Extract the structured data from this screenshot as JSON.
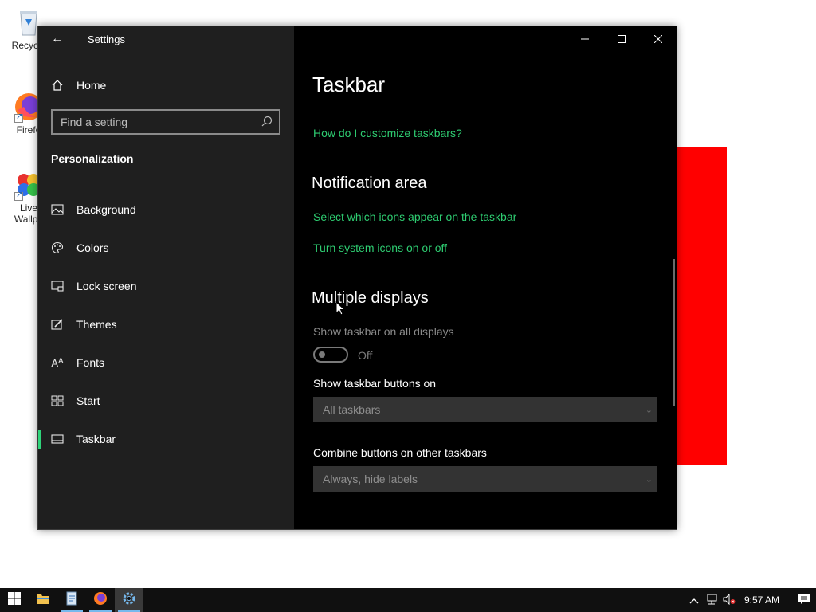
{
  "desktop": {
    "icons": [
      {
        "label": "Recycle",
        "icon": "recycle-bin-icon"
      },
      {
        "label": "Firefo",
        "icon": "firefox-icon"
      },
      {
        "label": "Live",
        "label2": "Wallpa",
        "icon": "live-wallpaper-icon"
      }
    ]
  },
  "window": {
    "title": "Settings",
    "back_icon": "arrow-left-icon",
    "caption": {
      "minimize": "minimize-icon",
      "maximize": "maximize-icon",
      "close": "close-icon"
    }
  },
  "sidebar": {
    "home_label": "Home",
    "search_placeholder": "Find a setting",
    "section_title": "Personalization",
    "items": [
      {
        "label": "Background",
        "icon": "picture-icon"
      },
      {
        "label": "Colors",
        "icon": "palette-icon"
      },
      {
        "label": "Lock screen",
        "icon": "lock-screen-icon"
      },
      {
        "label": "Themes",
        "icon": "brush-icon"
      },
      {
        "label": "Fonts",
        "icon": "font-icon"
      },
      {
        "label": "Start",
        "icon": "start-grid-icon"
      },
      {
        "label": "Taskbar",
        "icon": "taskbar-icon",
        "active": true
      }
    ],
    "accent_color": "#2fd47a"
  },
  "main": {
    "page_title": "Taskbar",
    "help_link": "How do I customize taskbars?",
    "notification_area": {
      "heading": "Notification area",
      "link1": "Select which icons appear on the taskbar",
      "link2": "Turn system icons on or off"
    },
    "multiple_displays": {
      "heading": "Multiple displays",
      "show_all_label": "Show taskbar on all displays",
      "toggle_state": "Off",
      "buttons_on_label": "Show taskbar buttons on",
      "buttons_on_value": "All taskbars",
      "combine_label": "Combine buttons on other taskbars",
      "combine_value": "Always, hide labels"
    },
    "link_color": "#2ecc71"
  },
  "taskbar": {
    "apps": [
      "windows-start-icon",
      "file-explorer-icon",
      "documents-icon",
      "firefox-icon",
      "settings-icon"
    ],
    "tray": [
      "chevron-up-icon",
      "network-icon",
      "volume-muted-icon"
    ],
    "time": "9:57 AM",
    "notification_icon": "action-center-icon"
  }
}
